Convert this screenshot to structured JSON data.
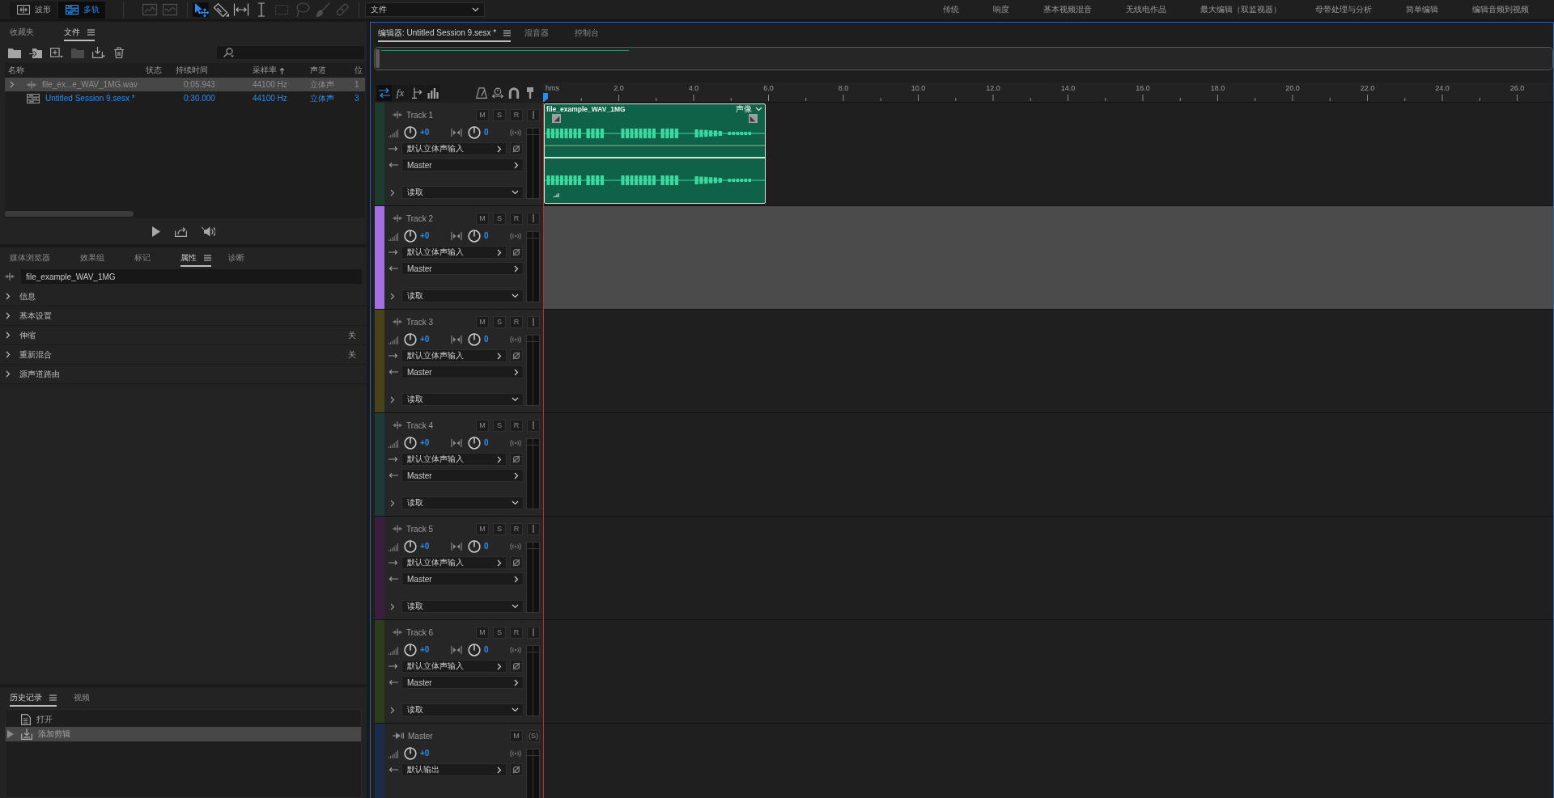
{
  "toolbar": {
    "view_modes": [
      {
        "label": "波形",
        "kind": "waveform",
        "selected": false
      },
      {
        "label": "多轨",
        "kind": "multitrack",
        "selected": true
      }
    ],
    "tool_groups": [
      {
        "tools": [
          {
            "kind": "spectral-frequency",
            "selected": false,
            "disabled": true
          },
          {
            "kind": "spectral-pitch",
            "selected": false,
            "disabled": true
          }
        ]
      },
      {
        "tools": [
          {
            "kind": "move",
            "selected": true,
            "disabled": false
          },
          {
            "kind": "razor",
            "selected": false,
            "disabled": false
          },
          {
            "kind": "slip",
            "selected": false,
            "disabled": false
          },
          {
            "kind": "time-selection",
            "selected": false,
            "disabled": false
          },
          {
            "kind": "marquee",
            "selected": false,
            "disabled": true
          },
          {
            "kind": "lasso",
            "selected": false,
            "disabled": true
          },
          {
            "kind": "brush",
            "selected": false,
            "disabled": true
          },
          {
            "kind": "healing",
            "selected": false,
            "disabled": true
          }
        ]
      }
    ],
    "workspace_select": {
      "value": "文件"
    },
    "workspaces": [
      "传统",
      "响度",
      "基本视频混音",
      "无线电作品",
      "最大编辑（双监视器）",
      "母带处理与分析",
      "简单编辑",
      "编辑音频到视频"
    ]
  },
  "files_panel": {
    "tabs": [
      {
        "label": "收藏夹",
        "selected": false
      },
      {
        "label": "文件",
        "selected": true
      }
    ],
    "columns": [
      {
        "label": "名称",
        "sorted": false
      },
      {
        "label": "状态",
        "sorted": false
      },
      {
        "label": "持续时间",
        "sorted": false
      },
      {
        "label": "采样率",
        "sorted": true
      },
      {
        "label": "声道",
        "sorted": false
      },
      {
        "label": "位",
        "sorted": false
      }
    ],
    "rows": [
      {
        "kind": "audio",
        "name": "file_ex...e_WAV_1MG.wav",
        "duration": "0:05.943",
        "sample_rate": "44100 Hz",
        "channels": "立体声",
        "column_6": "1",
        "selected": true,
        "open": false
      },
      {
        "kind": "session",
        "name": "Untitled Session 9.sesx *",
        "duration": "0:30.000",
        "sample_rate": "44100 Hz",
        "channels": "立体声",
        "column_6": "3",
        "selected": false,
        "open": true
      }
    ]
  },
  "properties_panel": {
    "tabs": [
      {
        "label": "媒体浏览器",
        "selected": false
      },
      {
        "label": "效果组",
        "selected": false
      },
      {
        "label": "标记",
        "selected": false
      },
      {
        "label": "属性",
        "selected": true
      },
      {
        "label": "诊断",
        "selected": false
      }
    ],
    "name_field": {
      "value": "file_example_WAV_1MG"
    },
    "sections": [
      {
        "label": "信息",
        "expanded": false
      },
      {
        "label": "基本设置",
        "expanded": false
      },
      {
        "label": "伸缩",
        "expanded": false,
        "status": "关"
      },
      {
        "label": "重新混合",
        "expanded": false,
        "status": "关"
      },
      {
        "label": "源声道路由",
        "expanded": false
      }
    ]
  },
  "history_panel": {
    "tabs": [
      {
        "label": "历史记录",
        "selected": true
      },
      {
        "label": "视频",
        "selected": false
      }
    ],
    "items": [
      {
        "label": "打开",
        "kind": "open",
        "selected": false
      },
      {
        "label": "添加剪辑",
        "kind": "add-clip",
        "selected": true
      }
    ]
  },
  "editor": {
    "tabs": [
      {
        "label": "编辑器: Untitled Session 9.sesx *",
        "selected": true
      },
      {
        "label": "混音器",
        "selected": false
      },
      {
        "label": "控制台",
        "selected": false
      }
    ],
    "view_buttons": [
      {
        "kind": "inputs-outputs",
        "selected": true
      },
      {
        "kind": "effects",
        "label": "fx",
        "selected": false
      },
      {
        "kind": "sends",
        "selected": false
      },
      {
        "kind": "eq",
        "selected": false
      }
    ],
    "ruler": [
      "hms",
      "2.0",
      "4.0",
      "6.0",
      "8.0",
      "10.0",
      "12.0",
      "14.0",
      "16.0",
      "18.0",
      "20.0",
      "22.0",
      "24.0",
      "26.0"
    ],
    "tracks": [
      {
        "kind": "audio",
        "name": "Track 1",
        "color": "#1e3b2d",
        "selected": false,
        "buttons": [
          "M",
          "S",
          "R"
        ],
        "volume": "+0",
        "pan": "0",
        "input": "默认立体声输入",
        "output": "Master",
        "automation": "读取",
        "clips": [
          {
            "name": "file_example_WAV_1MG",
            "mode": "声像"
          }
        ]
      },
      {
        "kind": "audio",
        "name": "Track 2",
        "color": "#a66fe0",
        "selected": true,
        "buttons": [
          "M",
          "S",
          "R"
        ],
        "volume": "+0",
        "pan": "0",
        "input": "默认立体声输入",
        "output": "Master",
        "automation": "读取"
      },
      {
        "kind": "audio",
        "name": "Track 3",
        "color": "#48431a",
        "selected": false,
        "buttons": [
          "M",
          "S",
          "R"
        ],
        "volume": "+0",
        "pan": "0",
        "input": "默认立体声输入",
        "output": "Master",
        "automation": "读取"
      },
      {
        "kind": "audio",
        "name": "Track 4",
        "color": "#1d3938",
        "selected": false,
        "buttons": [
          "M",
          "S",
          "R"
        ],
        "volume": "+0",
        "pan": "0",
        "input": "默认立体声输入",
        "output": "Master",
        "automation": "读取"
      },
      {
        "kind": "audio",
        "name": "Track 5",
        "color": "#3a1d3f",
        "selected": false,
        "buttons": [
          "M",
          "S",
          "R"
        ],
        "volume": "+0",
        "pan": "0",
        "input": "默认立体声输入",
        "output": "Master",
        "automation": "读取"
      },
      {
        "kind": "audio",
        "name": "Track 6",
        "color": "#2c3d1d",
        "selected": false,
        "buttons": [
          "M",
          "S",
          "R"
        ],
        "volume": "+0",
        "pan": "0",
        "input": "默认立体声输入",
        "output": "Master",
        "automation": "读取"
      },
      {
        "kind": "master",
        "name": "Master",
        "color": "#1c2b47",
        "selected": false,
        "buttons": [
          "M",
          "(S)"
        ],
        "volume": "+0",
        "output": "默认输出"
      }
    ]
  }
}
